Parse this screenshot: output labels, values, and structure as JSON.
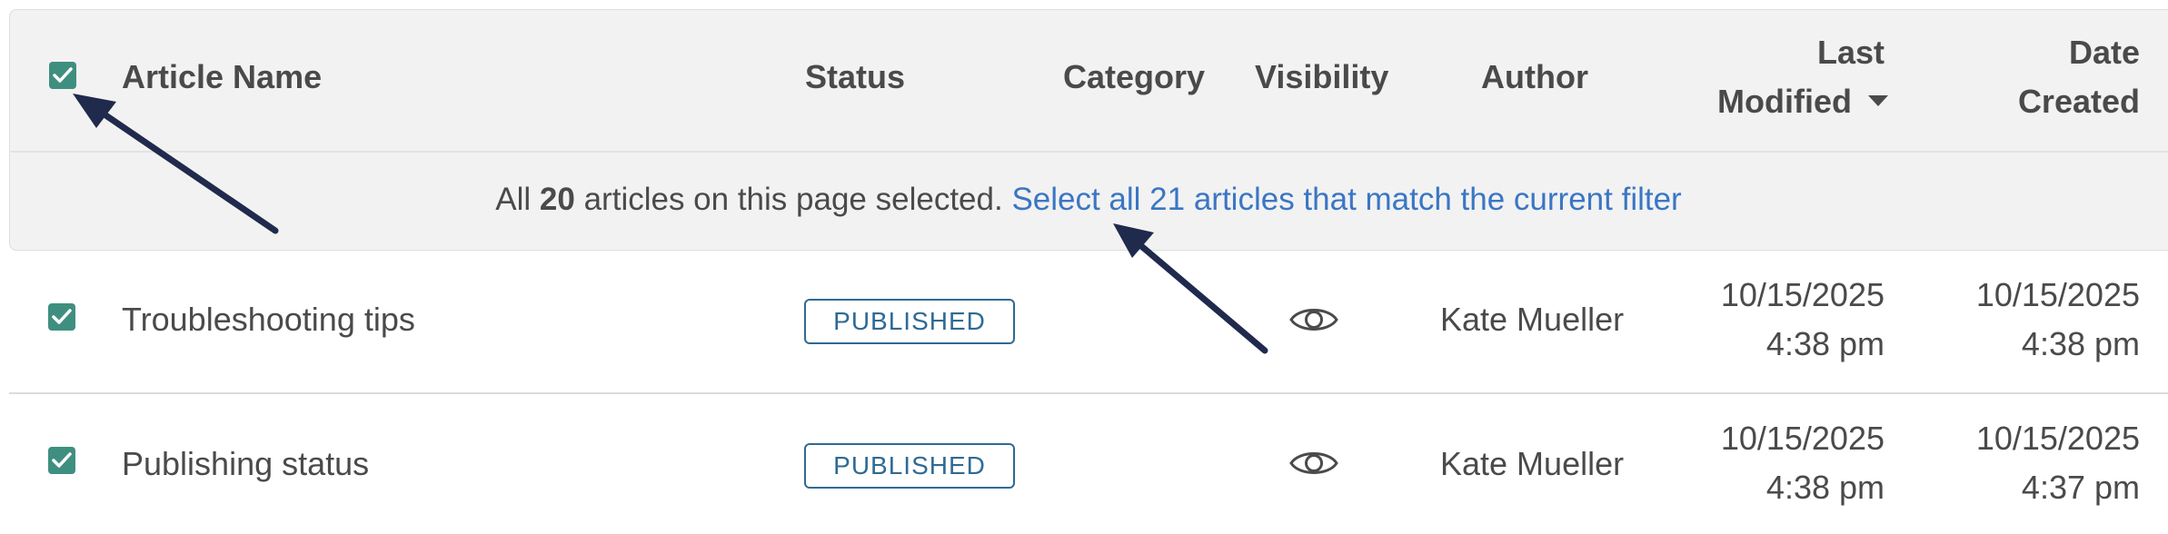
{
  "columns": {
    "article_name": "Article Name",
    "status": "Status",
    "category": "Category",
    "visibility": "Visibility",
    "author": "Author",
    "last_modified_line1": "Last",
    "last_modified_line2": "Modified",
    "date_created_line1": "Date",
    "date_created_line2": "Created"
  },
  "sort": {
    "column": "Last Modified",
    "direction": "descending",
    "icon": "caret-down-icon"
  },
  "select_all_checked": true,
  "banner": {
    "prefix": "All",
    "count": "20",
    "suffix": "articles on this page selected.",
    "link": "Select all 21 articles that match the current filter"
  },
  "rows": [
    {
      "checked": true,
      "name": "Troubleshooting tips",
      "status": "PUBLISHED",
      "visibility_icon": "eye-icon",
      "author": "Kate Mueller",
      "modified_date": "10/15/2025",
      "modified_time": "4:38 pm",
      "created_date": "10/15/2025",
      "created_time": "4:38 pm"
    },
    {
      "checked": true,
      "name": "Publishing status",
      "status": "PUBLISHED",
      "visibility_icon": "eye-icon",
      "author": "Kate Mueller",
      "modified_date": "10/15/2025",
      "modified_time": "4:38 pm",
      "created_date": "10/15/2025",
      "created_time": "4:37 pm"
    }
  ],
  "colors": {
    "checkbox": "#3f8f80",
    "link": "#3a76c4",
    "badge": "#2f6a94",
    "header_bg": "#f2f2f2",
    "annotation_arrow": "#1f2a4d"
  }
}
